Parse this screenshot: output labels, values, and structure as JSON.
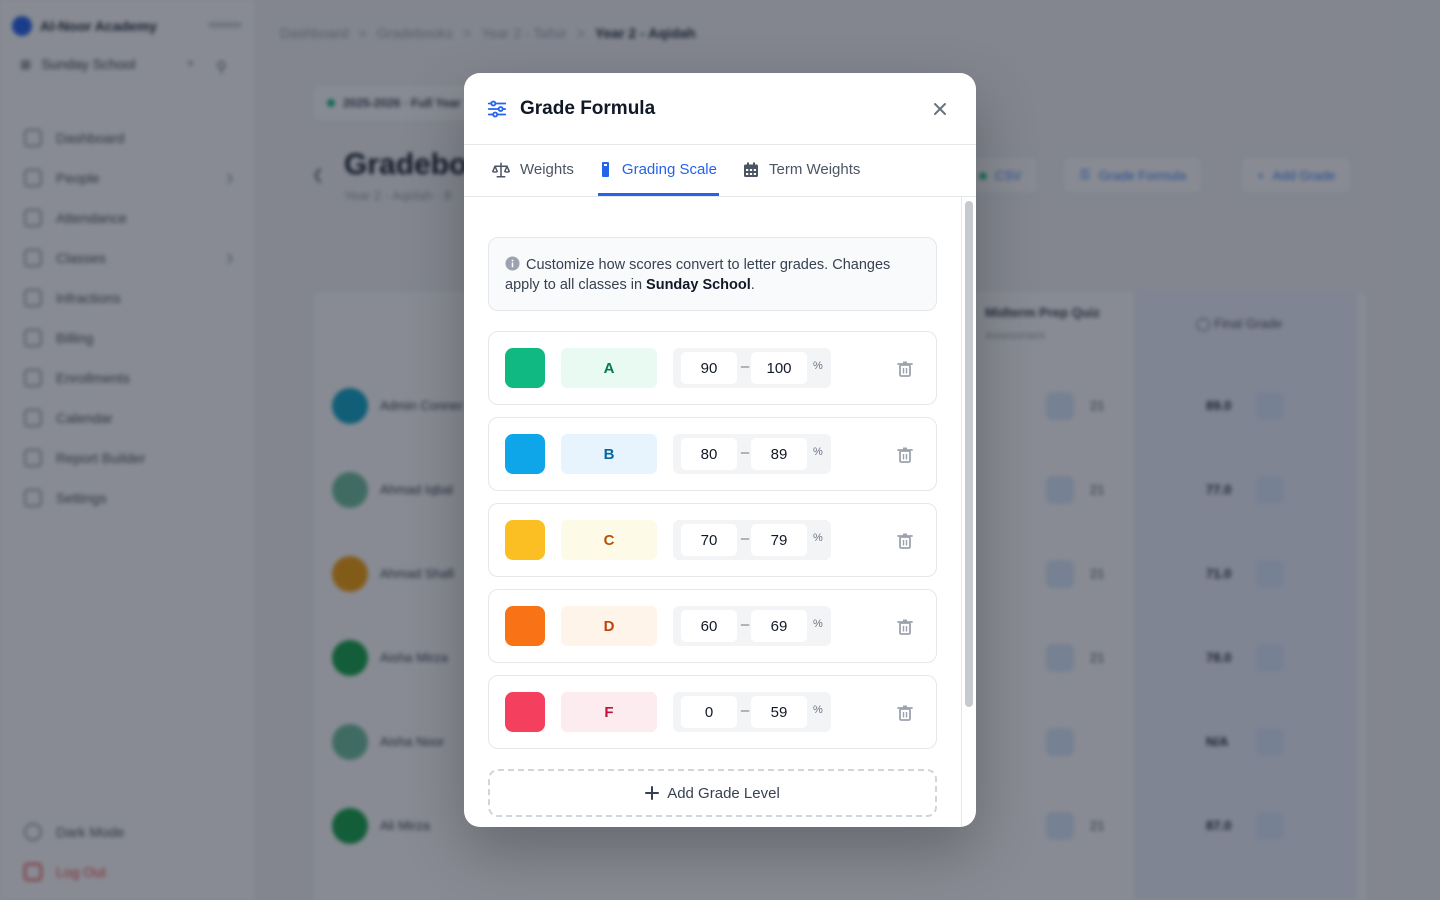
{
  "background": {
    "brand": "Al-Noor Academy",
    "school": "Sunday School",
    "nav": [
      "Dashboard",
      "People",
      "Attendance",
      "Classes",
      "Infractions",
      "Billing",
      "Enrollments",
      "Calendar",
      "Report Builder",
      "Settings"
    ],
    "nav_bottom": [
      "Dark Mode",
      "Log Out"
    ],
    "breadcrumb": [
      "Dashboard",
      "Gradebooks",
      "Year 2 - Tafsir",
      "Year 2 - Aqidah"
    ],
    "term": "2025-2026 · Full Year",
    "page_title": "Gradebook",
    "page_subtitle": "Year 2 - Aqidah · 8",
    "toolbar": {
      "csv": "CSV",
      "grade_formula": "Grade Formula",
      "add_grade": "Add Grade"
    },
    "column": {
      "title": "Midterm Prep Quiz",
      "sub": "Assessment"
    },
    "final_grade_header": "Final Grade",
    "students": [
      {
        "name": "Admin Conner",
        "color": "#0ea5c6",
        "score": "21",
        "final": "89.0"
      },
      {
        "name": "Ahmad Iqbal",
        "color": "#6fbf9f",
        "score": "21",
        "final": "77.0"
      },
      {
        "name": "Ahmad Shafi",
        "color": "#f59e0b",
        "score": "21",
        "final": "71.0"
      },
      {
        "name": "Aisha Mirza",
        "color": "#16a34a",
        "score": "21",
        "final": "78.0"
      },
      {
        "name": "Aisha Noor",
        "color": "#6fbf9f",
        "score": "",
        "final": "N/A"
      },
      {
        "name": "Ali Mirza",
        "color": "#16a34a",
        "score": "21",
        "final": "87.0"
      }
    ]
  },
  "modal": {
    "title": "Grade Formula",
    "icons": {
      "header": "sliders-icon",
      "close": "close-icon"
    },
    "tabs": [
      {
        "label": "Weights",
        "icon": "scale-icon",
        "active": false
      },
      {
        "label": "Grading Scale",
        "icon": "bookmark-icon",
        "active": true
      },
      {
        "label": "Term Weights",
        "icon": "calendar-icon",
        "active": false
      }
    ],
    "info": {
      "text_before": "Customize how scores convert to letter grades. Changes apply to all classes in ",
      "school": "Sunday School",
      "text_after": "."
    },
    "grades": [
      {
        "letter": "A",
        "min": "90",
        "max": "100",
        "unit": "%",
        "color": "#10b981",
        "bg": "#e8faf1",
        "fg": "#047857"
      },
      {
        "letter": "B",
        "min": "80",
        "max": "89",
        "unit": "%",
        "color": "#0ea5e9",
        "bg": "#e8f4fd",
        "fg": "#0369a1"
      },
      {
        "letter": "C",
        "min": "70",
        "max": "79",
        "unit": "%",
        "color": "#fbbf24",
        "bg": "#fefae8",
        "fg": "#b45309"
      },
      {
        "letter": "D",
        "min": "60",
        "max": "69",
        "unit": "%",
        "color": "#f97316",
        "bg": "#fff4ea",
        "fg": "#c2410c"
      },
      {
        "letter": "F",
        "min": "0",
        "max": "59",
        "unit": "%",
        "color": "#f43f5e",
        "bg": "#fdecef",
        "fg": "#be123c"
      }
    ],
    "add_label": "Add Grade Level"
  }
}
